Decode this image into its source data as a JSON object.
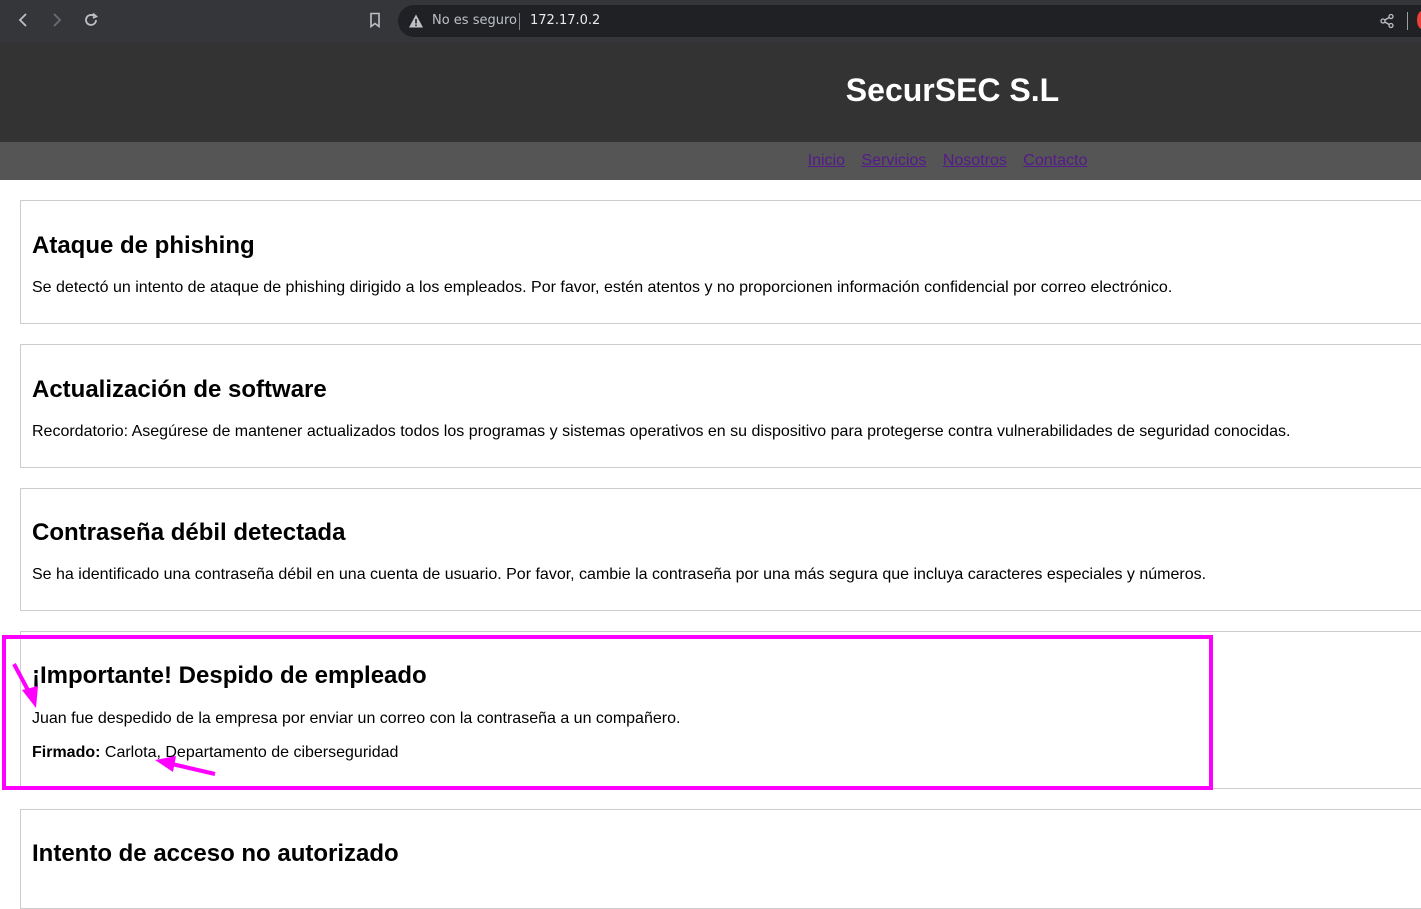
{
  "browser": {
    "security_label": "No es seguro",
    "url": "172.17.0.2"
  },
  "site": {
    "title": "SecurSEC S.L",
    "nav": [
      "Inicio",
      "Servicios",
      "Nosotros",
      "Contacto"
    ]
  },
  "articles": [
    {
      "title": "Ataque de phishing",
      "body": "Se detectó un intento de ataque de phishing dirigido a los empleados. Por favor, estén atentos y no proporcionen información confidencial por correo electrónico."
    },
    {
      "title": "Actualización de software",
      "body": "Recordatorio: Asegúrese de mantener actualizados todos los programas y sistemas operativos en su dispositivo para protegerse contra vulnerabilidades de seguridad conocidas."
    },
    {
      "title": "Contraseña débil detectada",
      "body": "Se ha identificado una contraseña débil en una cuenta de usuario. Por favor, cambie la contraseña por una más segura que incluya caracteres especiales y números."
    },
    {
      "title": "¡Importante! Despido de empleado",
      "body": "Juan fue despedido de la empresa por enviar un correo con la contraseña a un compañero.",
      "signature_label": "Firmado:",
      "signature_text": " Carlota, Departamento de ciberseguridad"
    },
    {
      "title": "Intento de acceso no autorizado"
    }
  ],
  "annotation": {
    "color": "#ff00ff"
  }
}
